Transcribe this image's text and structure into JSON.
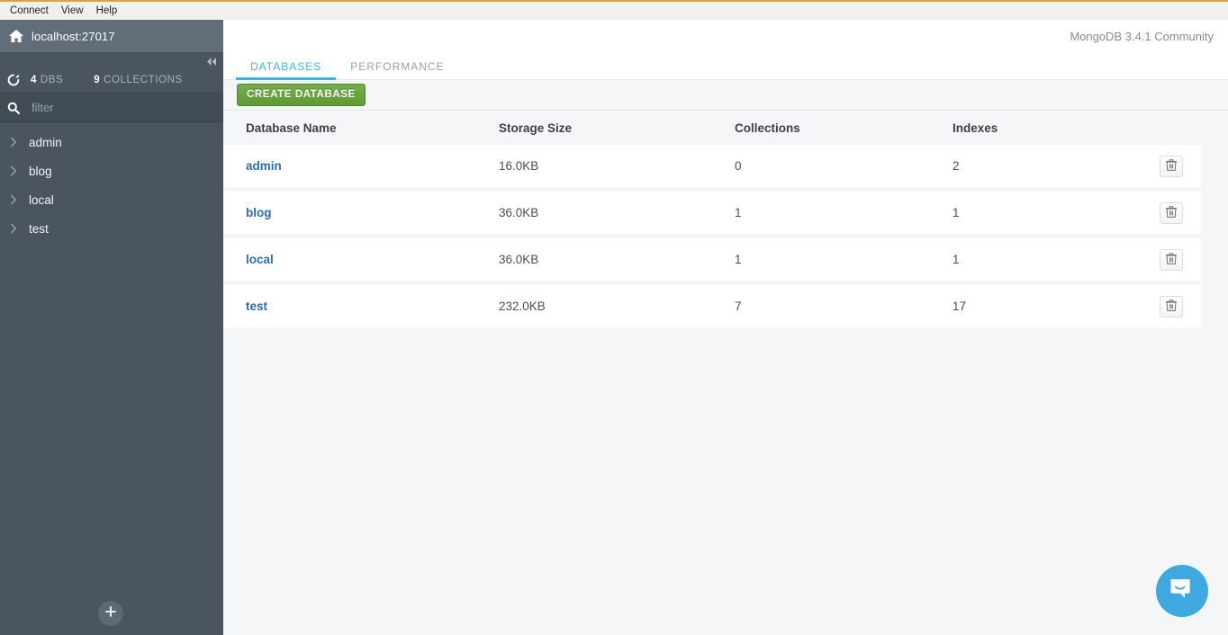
{
  "menubar": {
    "items": [
      {
        "label": "Connect"
      },
      {
        "label": "View"
      },
      {
        "label": "Help"
      }
    ]
  },
  "sidebar": {
    "connection": {
      "host_label": "localhost:27017",
      "home_icon": "home-icon"
    },
    "collapse_icon": "double-chevron-left-icon",
    "stats": {
      "refresh_icon": "refresh-icon",
      "db_count": "4",
      "db_label": "DBS",
      "collection_count": "9",
      "collection_label": "COLLECTIONS"
    },
    "filter": {
      "icon": "search-icon",
      "value": "",
      "placeholder": "filter"
    },
    "databases": [
      {
        "name": "admin",
        "chevron": "chevron-right-icon"
      },
      {
        "name": "blog",
        "chevron": "chevron-right-icon"
      },
      {
        "name": "local",
        "chevron": "chevron-right-icon"
      },
      {
        "name": "test",
        "chevron": "chevron-right-icon"
      }
    ],
    "add_button": {
      "icon": "plus-icon",
      "label": "+"
    }
  },
  "header": {
    "version": "MongoDB 3.4.1 Community"
  },
  "tabs": [
    {
      "label": "DATABASES",
      "active": true
    },
    {
      "label": "PERFORMANCE",
      "active": false
    }
  ],
  "toolbar": {
    "create_database_label": "CREATE DATABASE"
  },
  "table": {
    "columns": [
      "Database Name",
      "Storage Size",
      "Collections",
      "Indexes"
    ],
    "delete_icon": "trash-icon",
    "rows": [
      {
        "name": "admin",
        "storage": "16.0KB",
        "collections": "0",
        "indexes": "2"
      },
      {
        "name": "blog",
        "storage": "36.0KB",
        "collections": "1",
        "indexes": "1"
      },
      {
        "name": "local",
        "storage": "36.0KB",
        "collections": "1",
        "indexes": "1"
      },
      {
        "name": "test",
        "storage": "232.0KB",
        "collections": "7",
        "indexes": "17"
      }
    ]
  },
  "chat": {
    "icon": "chat-bubble-smile-icon"
  },
  "colors": {
    "accent_blue": "#43b1e5",
    "link_blue": "#2c6dad",
    "create_green": "#5f9a37",
    "sidebar_bg": "#4a5560",
    "chat_blue": "#3ea8e0",
    "window_border": "#d9a441"
  }
}
